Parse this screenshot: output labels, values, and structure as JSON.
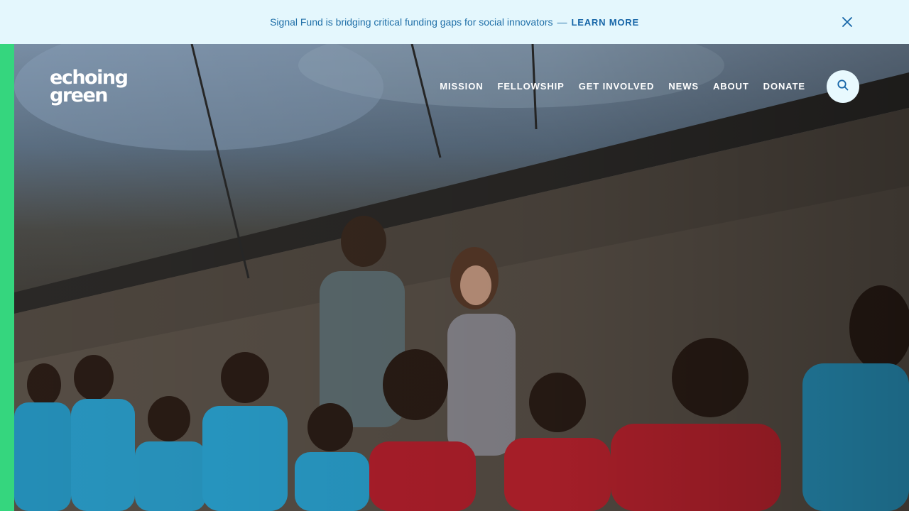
{
  "announcement": {
    "message": "Signal Fund is bridging critical funding gaps for social innovators",
    "separator": "—",
    "link_label": "LEARN MORE"
  },
  "brand": {
    "logo_line1": "echoing",
    "logo_line2": "green"
  },
  "nav": {
    "items": [
      {
        "label": "MISSION"
      },
      {
        "label": "FELLOWSHIP"
      },
      {
        "label": "GET INVOLVED"
      },
      {
        "label": "NEWS"
      },
      {
        "label": "ABOUT"
      },
      {
        "label": "DONATE"
      }
    ]
  },
  "icons": {
    "close": "close-icon",
    "search": "search-icon"
  },
  "colors": {
    "announcement_bg": "#e4f7fd",
    "announcement_text": "#1f6fa8",
    "accent_green": "#35d67e",
    "search_button_bg": "#e8f9fe"
  }
}
